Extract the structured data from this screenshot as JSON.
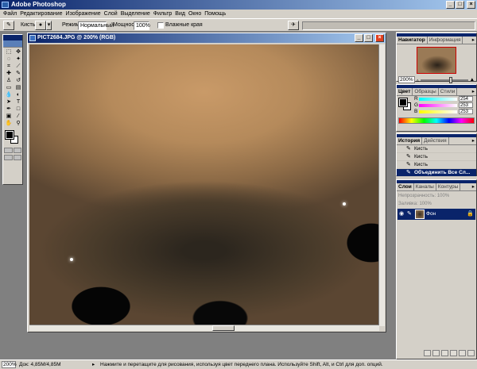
{
  "app": {
    "title": "Adobe Photoshop"
  },
  "menu": [
    "Файл",
    "Редактирование",
    "Изображение",
    "Слой",
    "Выделение",
    "Фильтр",
    "Вид",
    "Окно",
    "Помощь"
  ],
  "options": {
    "tool_label": "Кисть:",
    "brush_size": "●",
    "mode_label": "Режим:",
    "mode_value": "Нормальный",
    "opacity_label": "Мощность:",
    "opacity_value": "100%",
    "wet_edges_label": "Влажные края"
  },
  "document": {
    "title": "PICT2684.JPG @ 200% (RGB)"
  },
  "navigator": {
    "tabs": [
      "Навигатор",
      "Информация"
    ],
    "zoom": "200%"
  },
  "color": {
    "tabs": [
      "Цвет",
      "Образцы",
      "Стили"
    ],
    "channels": [
      {
        "label": "R",
        "value": "254",
        "gradient": "linear-gradient(90deg, #00ffff, #ffffff)"
      },
      {
        "label": "G",
        "value": "253",
        "gradient": "linear-gradient(90deg, #ff00ff, #ffffff)"
      },
      {
        "label": "B",
        "value": "253",
        "gradient": "linear-gradient(90deg, #ffff00, #ffffff)"
      }
    ]
  },
  "history": {
    "tabs": [
      "История",
      "Действия"
    ],
    "items": [
      {
        "label": "Кисть",
        "selected": false
      },
      {
        "label": "Кисть",
        "selected": false
      },
      {
        "label": "Кисть",
        "selected": false
      },
      {
        "label": "Объединить Все Сл...",
        "selected": true
      }
    ]
  },
  "layers": {
    "tabs": [
      "Слои",
      "Каналы",
      "Контуры"
    ],
    "opacity_label": "Непрозрачность:",
    "opacity_value": "100%",
    "fill_label": "Заливка:",
    "fill_value": "100%",
    "items": [
      {
        "name": "Фон"
      }
    ]
  },
  "status": {
    "zoom": "200%",
    "doc_size": "Док: 4,85M/4,85M",
    "hint": "Нажмите и перетащите для рисования, используя цвет переднего плана. Используйте Shift, Alt, и Ctrl для доп. опций."
  }
}
